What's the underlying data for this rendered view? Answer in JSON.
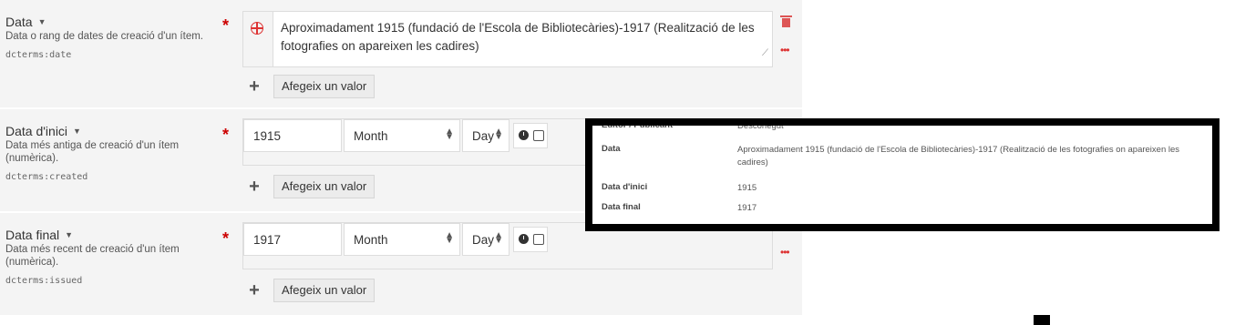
{
  "fields": [
    {
      "label": "Data",
      "description": "Data o rang de dates de creació d'un ítem.",
      "term": "dcterms:date",
      "value": "Aproximadament 1915 (fundació de l'Escola de Bibliotecàries)-1917 (Realització de les fotografies on apareixen les cadires)",
      "add_label": "Afegeix un valor"
    },
    {
      "label": "Data d'inici",
      "description": "Data més antiga de creació d'un ítem (numèrica).",
      "term": "dcterms:created",
      "year": "1915",
      "month_placeholder": "Month",
      "day_placeholder": "Day",
      "add_label": "Afegeix un valor"
    },
    {
      "label": "Data final",
      "description": "Data més recent de creació d'un ítem (numèrica).",
      "term": "dcterms:issued",
      "year": "1917",
      "month_placeholder": "Month",
      "day_placeholder": "Day",
      "add_label": "Afegeix un valor"
    }
  ],
  "overlay": {
    "rows": [
      {
        "label": "Editor / Publicant",
        "value": "Desconegut"
      },
      {
        "label": "Data",
        "value": "Aproximadament 1915 (fundació de l'Escola de Bibliotecàries)-1917 (Realització de les fotografies on apareixen les cadires)"
      },
      {
        "label": "Data d'inici",
        "value": "1915"
      },
      {
        "label": "Data final",
        "value": "1917"
      }
    ]
  },
  "colors": {
    "required": "#cc0000",
    "delete": "#dd5555",
    "overlay_border": "#000000"
  },
  "icons": {
    "language": "globe-icon",
    "delete": "trash-icon",
    "more": "ellipsis-icon",
    "add": "plus-icon",
    "time": "clock-icon"
  }
}
